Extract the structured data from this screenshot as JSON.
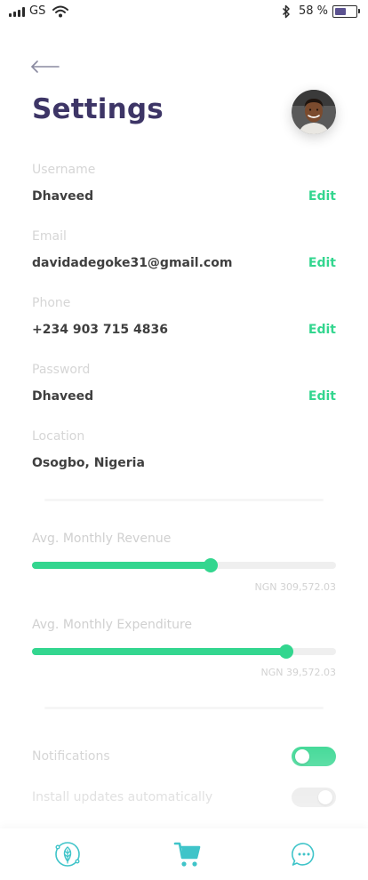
{
  "status_bar": {
    "carrier": "GS",
    "battery_text": "58 %",
    "battery_level": 0.58,
    "icons": [
      "signal-icon",
      "wifi-icon",
      "bluetooth-icon",
      "battery-icon"
    ]
  },
  "header": {
    "back_icon": "arrow-left-icon",
    "title": "Settings"
  },
  "fields": [
    {
      "label": "Username",
      "value": "Dhaveed",
      "action": "Edit"
    },
    {
      "label": "Email",
      "value": "davidadegoke31@gmail.com",
      "action": "Edit"
    },
    {
      "label": "Phone",
      "value": "+234 903 715 4836",
      "action": "Edit"
    },
    {
      "label": "Password",
      "value": "Dhaveed",
      "action": "Edit"
    },
    {
      "label": "Location",
      "value": "Osogbo, Nigeria"
    }
  ],
  "sliders": [
    {
      "label": "Avg. Monthly Revenue",
      "amount": "NGN 309,572.03",
      "level": 0.587
    },
    {
      "label": "Avg. Monthly Expenditure",
      "amount": "NGN 39,572.03",
      "level": 0.836
    }
  ],
  "toggles": [
    {
      "label": "Notifications",
      "state": "on"
    },
    {
      "label": "Install updates automatically",
      "state": "off"
    }
  ],
  "colors": {
    "accent": "#33d68f",
    "title": "#3d3566",
    "tab_icon": "#3fc4c9"
  },
  "tabbar": {
    "items": [
      "leaf-icon",
      "cart-icon",
      "chat-icon"
    ],
    "active": "cart-icon"
  }
}
